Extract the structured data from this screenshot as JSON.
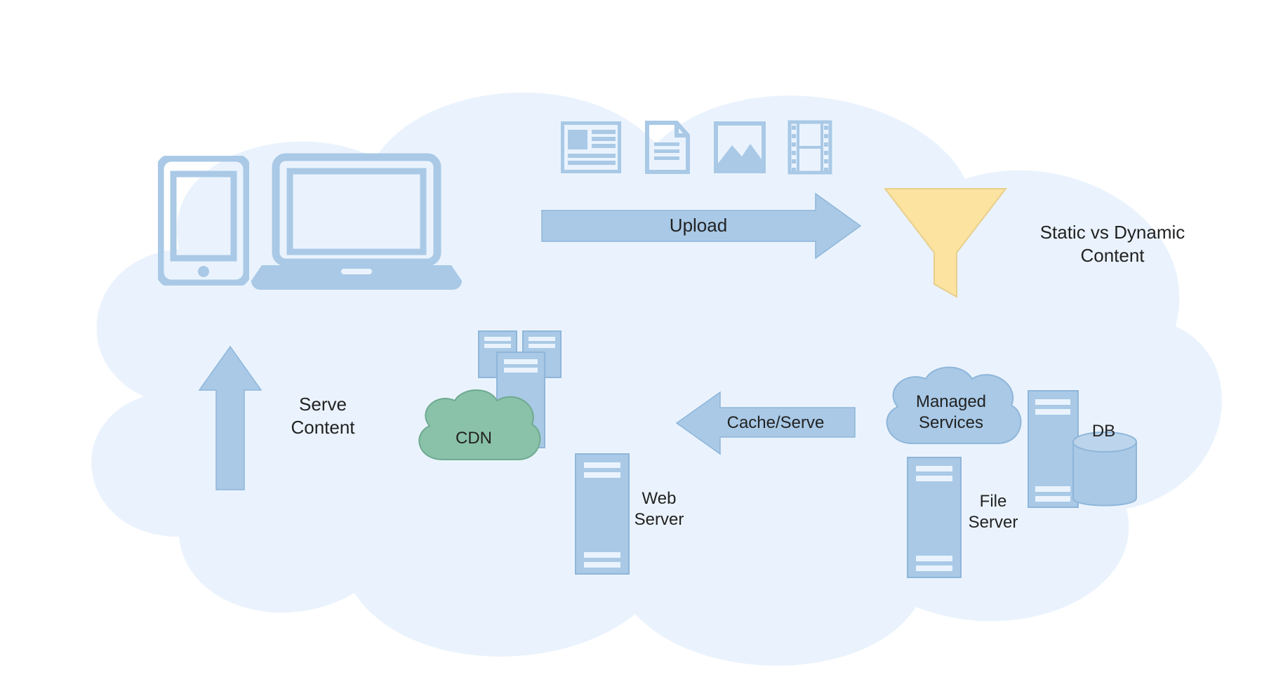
{
  "labels": {
    "upload": "Upload",
    "cache_serve": "Cache/Serve",
    "serve_content": "Serve\nContent",
    "static_dynamic": "Static vs Dynamic\nContent",
    "managed_services": "Managed\nServices",
    "cdn": "CDN",
    "web_server": "Web\nServer",
    "file_server": "File\nServer",
    "db": "DB"
  },
  "colors": {
    "cloud_bg": "#eaf3fd",
    "blue_fill": "#a9c9e6",
    "blue_stroke": "#8fb6da",
    "green_fill": "#8ac2a9",
    "green_stroke": "#6faa90",
    "funnel_fill": "#fce3a0",
    "funnel_stroke": "#e8cf8e"
  }
}
